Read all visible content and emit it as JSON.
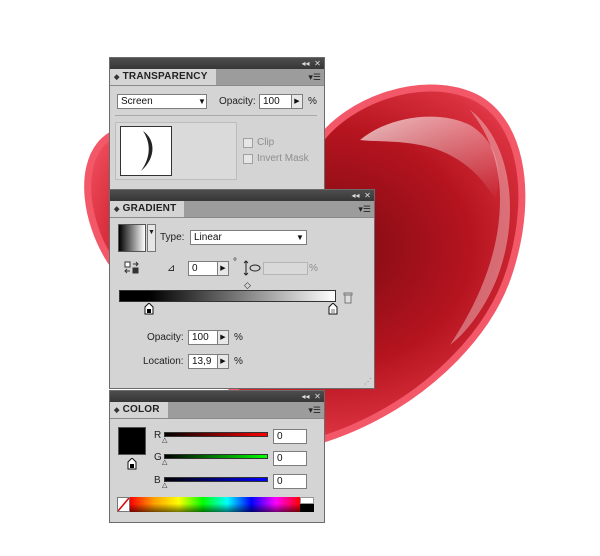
{
  "colors": {
    "heart_light": "#f56d7d",
    "heart_mid": "#d0212e",
    "heart_dark": "#8e0f18",
    "panel_bg": "#d4d4d4",
    "titlebar": "#404040"
  },
  "transparency": {
    "title": "TRANSPARENCY",
    "blend_mode": "Screen",
    "opacity_label": "Opacity:",
    "opacity_value": "100",
    "opacity_unit": "%",
    "clip_label": "Clip",
    "invert_mask_label": "Invert Mask",
    "icons": [
      "collapse-icon",
      "close-icon",
      "panel-menu-icon",
      "dropdown-arrow-icon",
      "stepper-arrow-icon"
    ]
  },
  "gradient": {
    "title": "GRADIENT",
    "type_label": "Type:",
    "type_value": "Linear",
    "angle_value": "0",
    "degree_symbol": "°",
    "aspect_unit": "%",
    "opacity_label": "Opacity:",
    "opacity_value": "100",
    "opacity_unit": "%",
    "location_label": "Location:",
    "location_value": "13,9",
    "location_unit": "%",
    "gradient_from": "#000000",
    "gradient_to": "#ffffff",
    "stop_positions_pct": [
      13.9,
      100
    ],
    "midpoint_pct": 58
  },
  "color": {
    "title": "COLOR",
    "r_label": "R",
    "g_label": "G",
    "b_label": "B",
    "r_value": "0",
    "g_value": "0",
    "b_value": "0",
    "swatch": "#000000"
  }
}
